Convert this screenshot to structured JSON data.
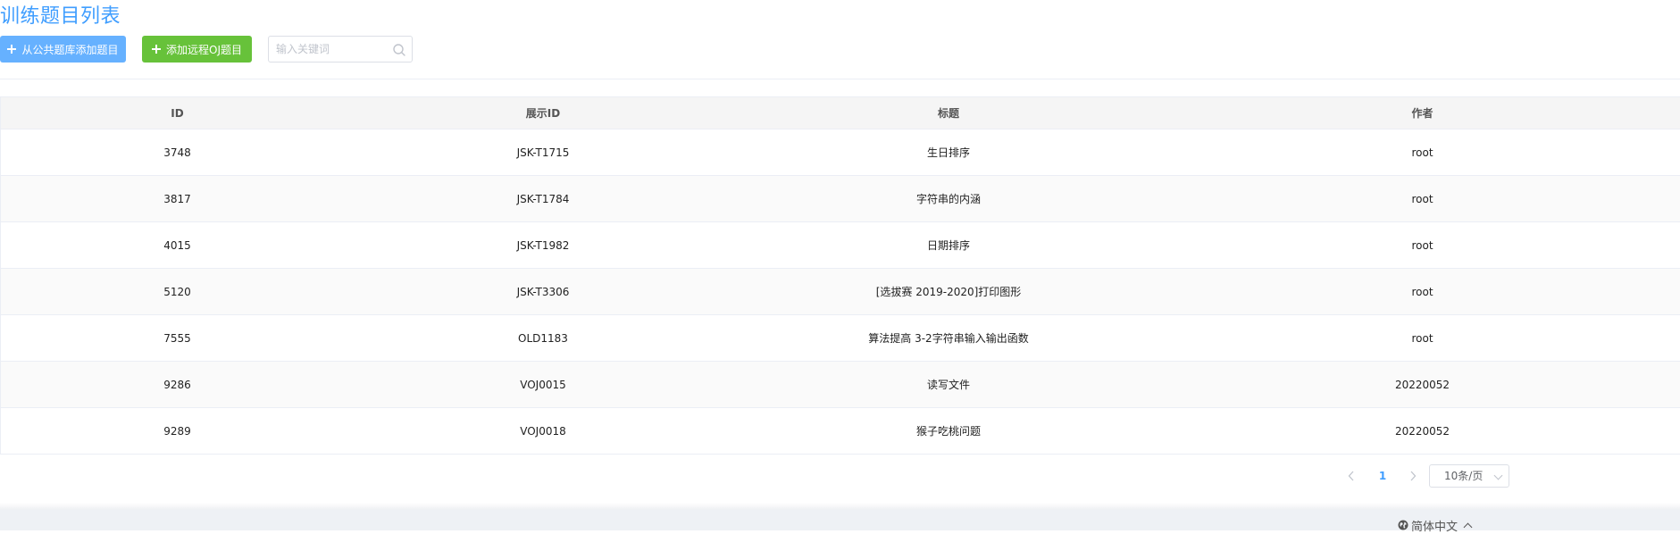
{
  "page": {
    "title": "训练题目列表"
  },
  "toolbar": {
    "add_public_label": "从公共题库添加题目",
    "add_remote_label": "添加远程OJ题目",
    "search_placeholder": "输入关键词",
    "search_value": ""
  },
  "table": {
    "columns": [
      "ID",
      "展示ID",
      "标题",
      "作者"
    ],
    "rows": [
      {
        "id": "3748",
        "display_id": "JSK-T1715",
        "title": "生日排序",
        "author": "root"
      },
      {
        "id": "3817",
        "display_id": "JSK-T1784",
        "title": "字符串的内涵",
        "author": "root"
      },
      {
        "id": "4015",
        "display_id": "JSK-T1982",
        "title": "日期排序",
        "author": "root"
      },
      {
        "id": "5120",
        "display_id": "JSK-T3306",
        "title": "[选拔赛 2019-2020]打印图形",
        "author": "root"
      },
      {
        "id": "7555",
        "display_id": "OLD1183",
        "title": "算法提高 3-2字符串输入输出函数",
        "author": "root"
      },
      {
        "id": "9286",
        "display_id": "VOJ0015",
        "title": "读写文件",
        "author": "20220052"
      },
      {
        "id": "9289",
        "display_id": "VOJ0018",
        "title": "猴子吃桃问题",
        "author": "20220052"
      }
    ]
  },
  "pagination": {
    "prev_icon": "chevron-left-icon",
    "next_icon": "chevron-right-icon",
    "current_page": "1",
    "page_size_label": "10条/页"
  },
  "footer": {
    "language_label": "简体中文"
  },
  "colors": {
    "primary": "#409eff",
    "public_button": "#66b1ff",
    "remote_button": "#67c23a"
  }
}
